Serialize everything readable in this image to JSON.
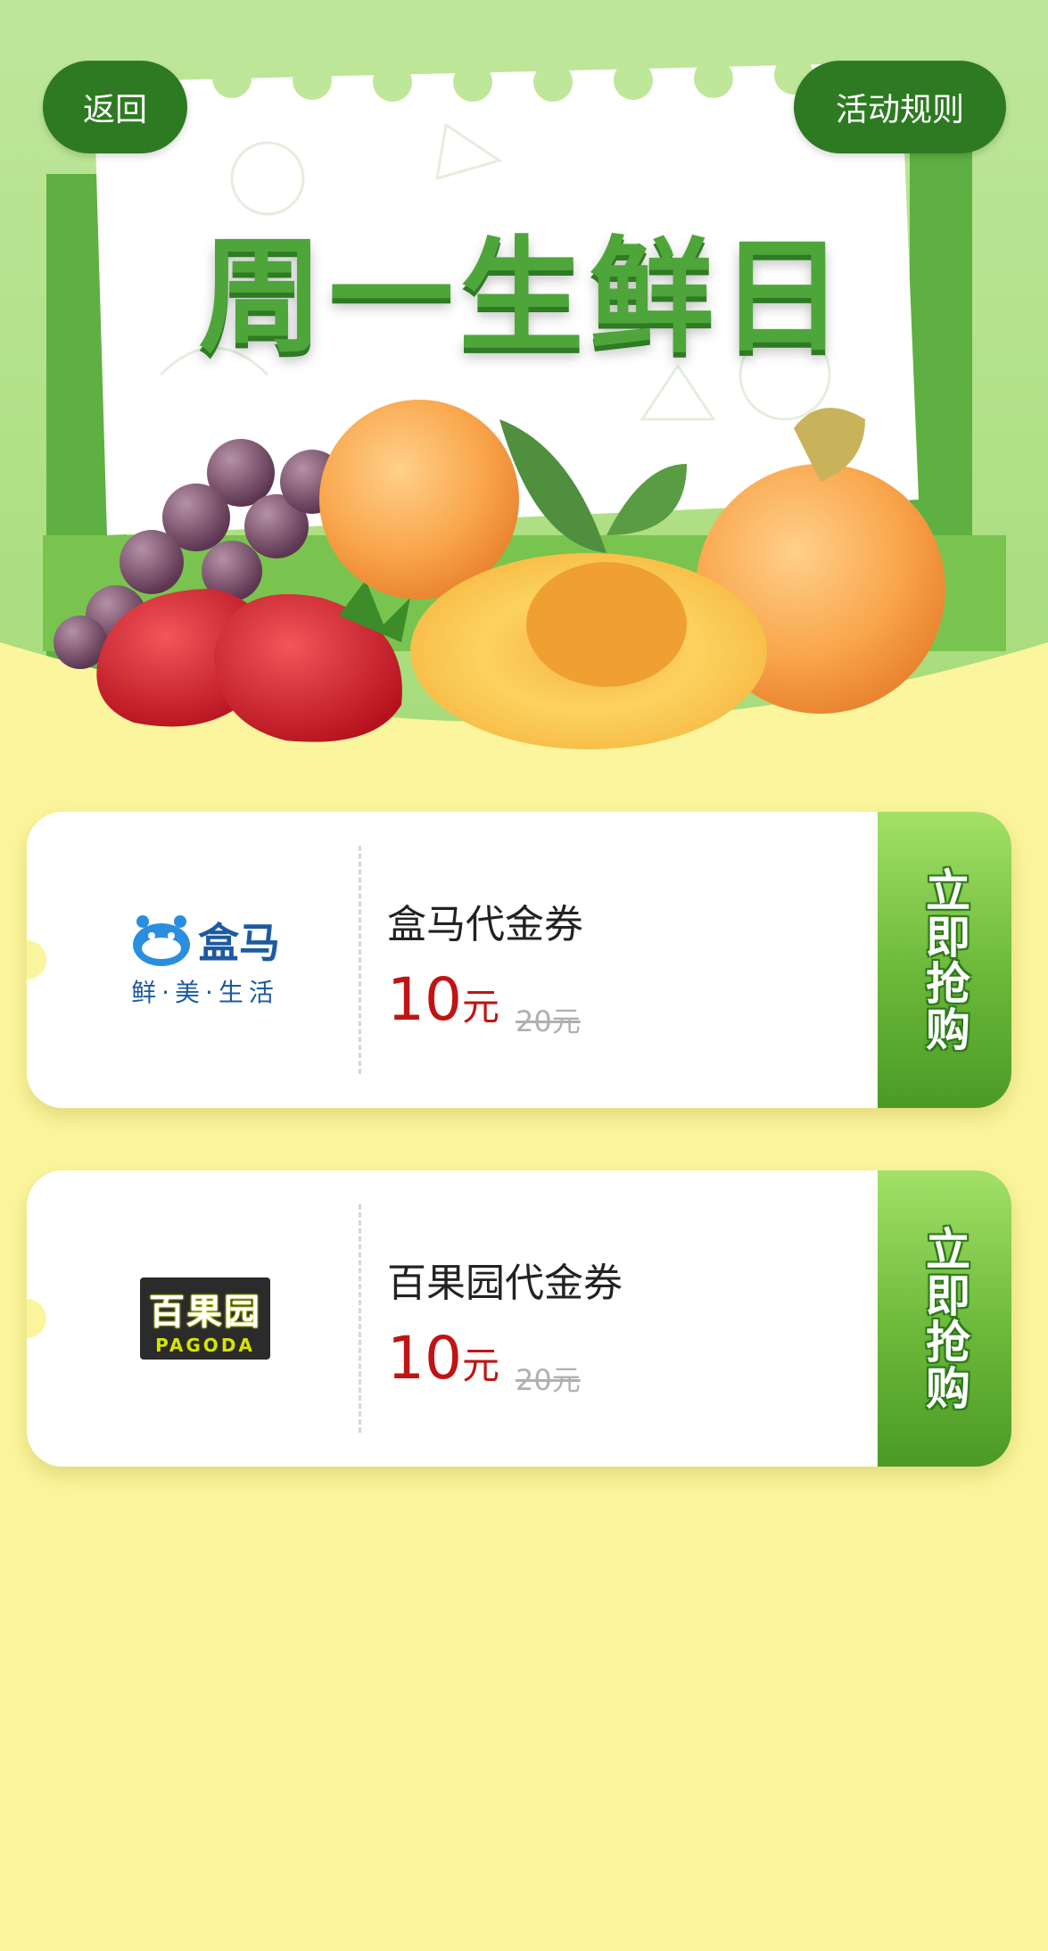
{
  "header": {
    "back_label": "返回",
    "rules_label": "活动规则",
    "banner_title": "周一生鲜日"
  },
  "coupons": [
    {
      "logo_text": "盒马",
      "logo_sub": "鲜·美·生活",
      "title": "盒马代金券",
      "price": "10",
      "price_unit": "元",
      "original_price": "20元",
      "cta": "立即抢购"
    },
    {
      "logo_text": "百果园",
      "logo_sub": "PAGODA",
      "title": "百果园代金券",
      "price": "10",
      "price_unit": "元",
      "original_price": "20元",
      "cta": "立即抢购"
    }
  ],
  "colors": {
    "page_bg": "#fbf59d",
    "hero_green": "#b9e596",
    "pill_green": "#2e7a22",
    "price_red": "#c01414",
    "cta_green": "#6bb83a"
  }
}
